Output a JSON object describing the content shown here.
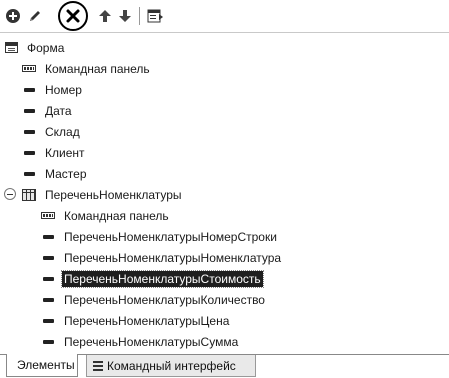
{
  "toolbar": {
    "buttons": [
      {
        "icon": "add-icon"
      },
      {
        "icon": "pencil-icon"
      },
      {
        "icon": "delete-icon"
      },
      {
        "icon": "arrow-up-icon"
      },
      {
        "icon": "arrow-down-icon"
      },
      {
        "icon": "form-view-icon"
      }
    ]
  },
  "tree": {
    "root": {
      "label": "Форма",
      "icon": "form-icon"
    },
    "items": [
      {
        "label": "Командная панель",
        "icon": "command-panel-icon"
      },
      {
        "label": "Номер",
        "icon": "field-icon"
      },
      {
        "label": "Дата",
        "icon": "field-icon"
      },
      {
        "label": "Склад",
        "icon": "field-icon"
      },
      {
        "label": "Клиент",
        "icon": "field-icon"
      },
      {
        "label": "Мастер",
        "icon": "field-icon"
      }
    ],
    "table": {
      "label": "ПереченьНоменклатуры",
      "icon": "table-icon",
      "expanded": true,
      "children": [
        {
          "label": "Командная панель",
          "icon": "command-panel-icon"
        },
        {
          "label": "ПереченьНоменклатурыНомерСтроки",
          "icon": "field-icon"
        },
        {
          "label": "ПереченьНоменклатурыНоменклатура",
          "icon": "field-icon"
        },
        {
          "label": "ПереченьНоменклатурыСтоимость",
          "icon": "field-icon",
          "selected": true
        },
        {
          "label": "ПереченьНоменклатурыКоличество",
          "icon": "field-icon"
        },
        {
          "label": "ПереченьНоменклатурыЦена",
          "icon": "field-icon"
        },
        {
          "label": "ПереченьНоменклатурыСумма",
          "icon": "field-icon"
        }
      ]
    }
  },
  "tabs": [
    {
      "label": "Элементы",
      "active": true
    },
    {
      "label": "Командный интерфейс",
      "active": false
    }
  ]
}
